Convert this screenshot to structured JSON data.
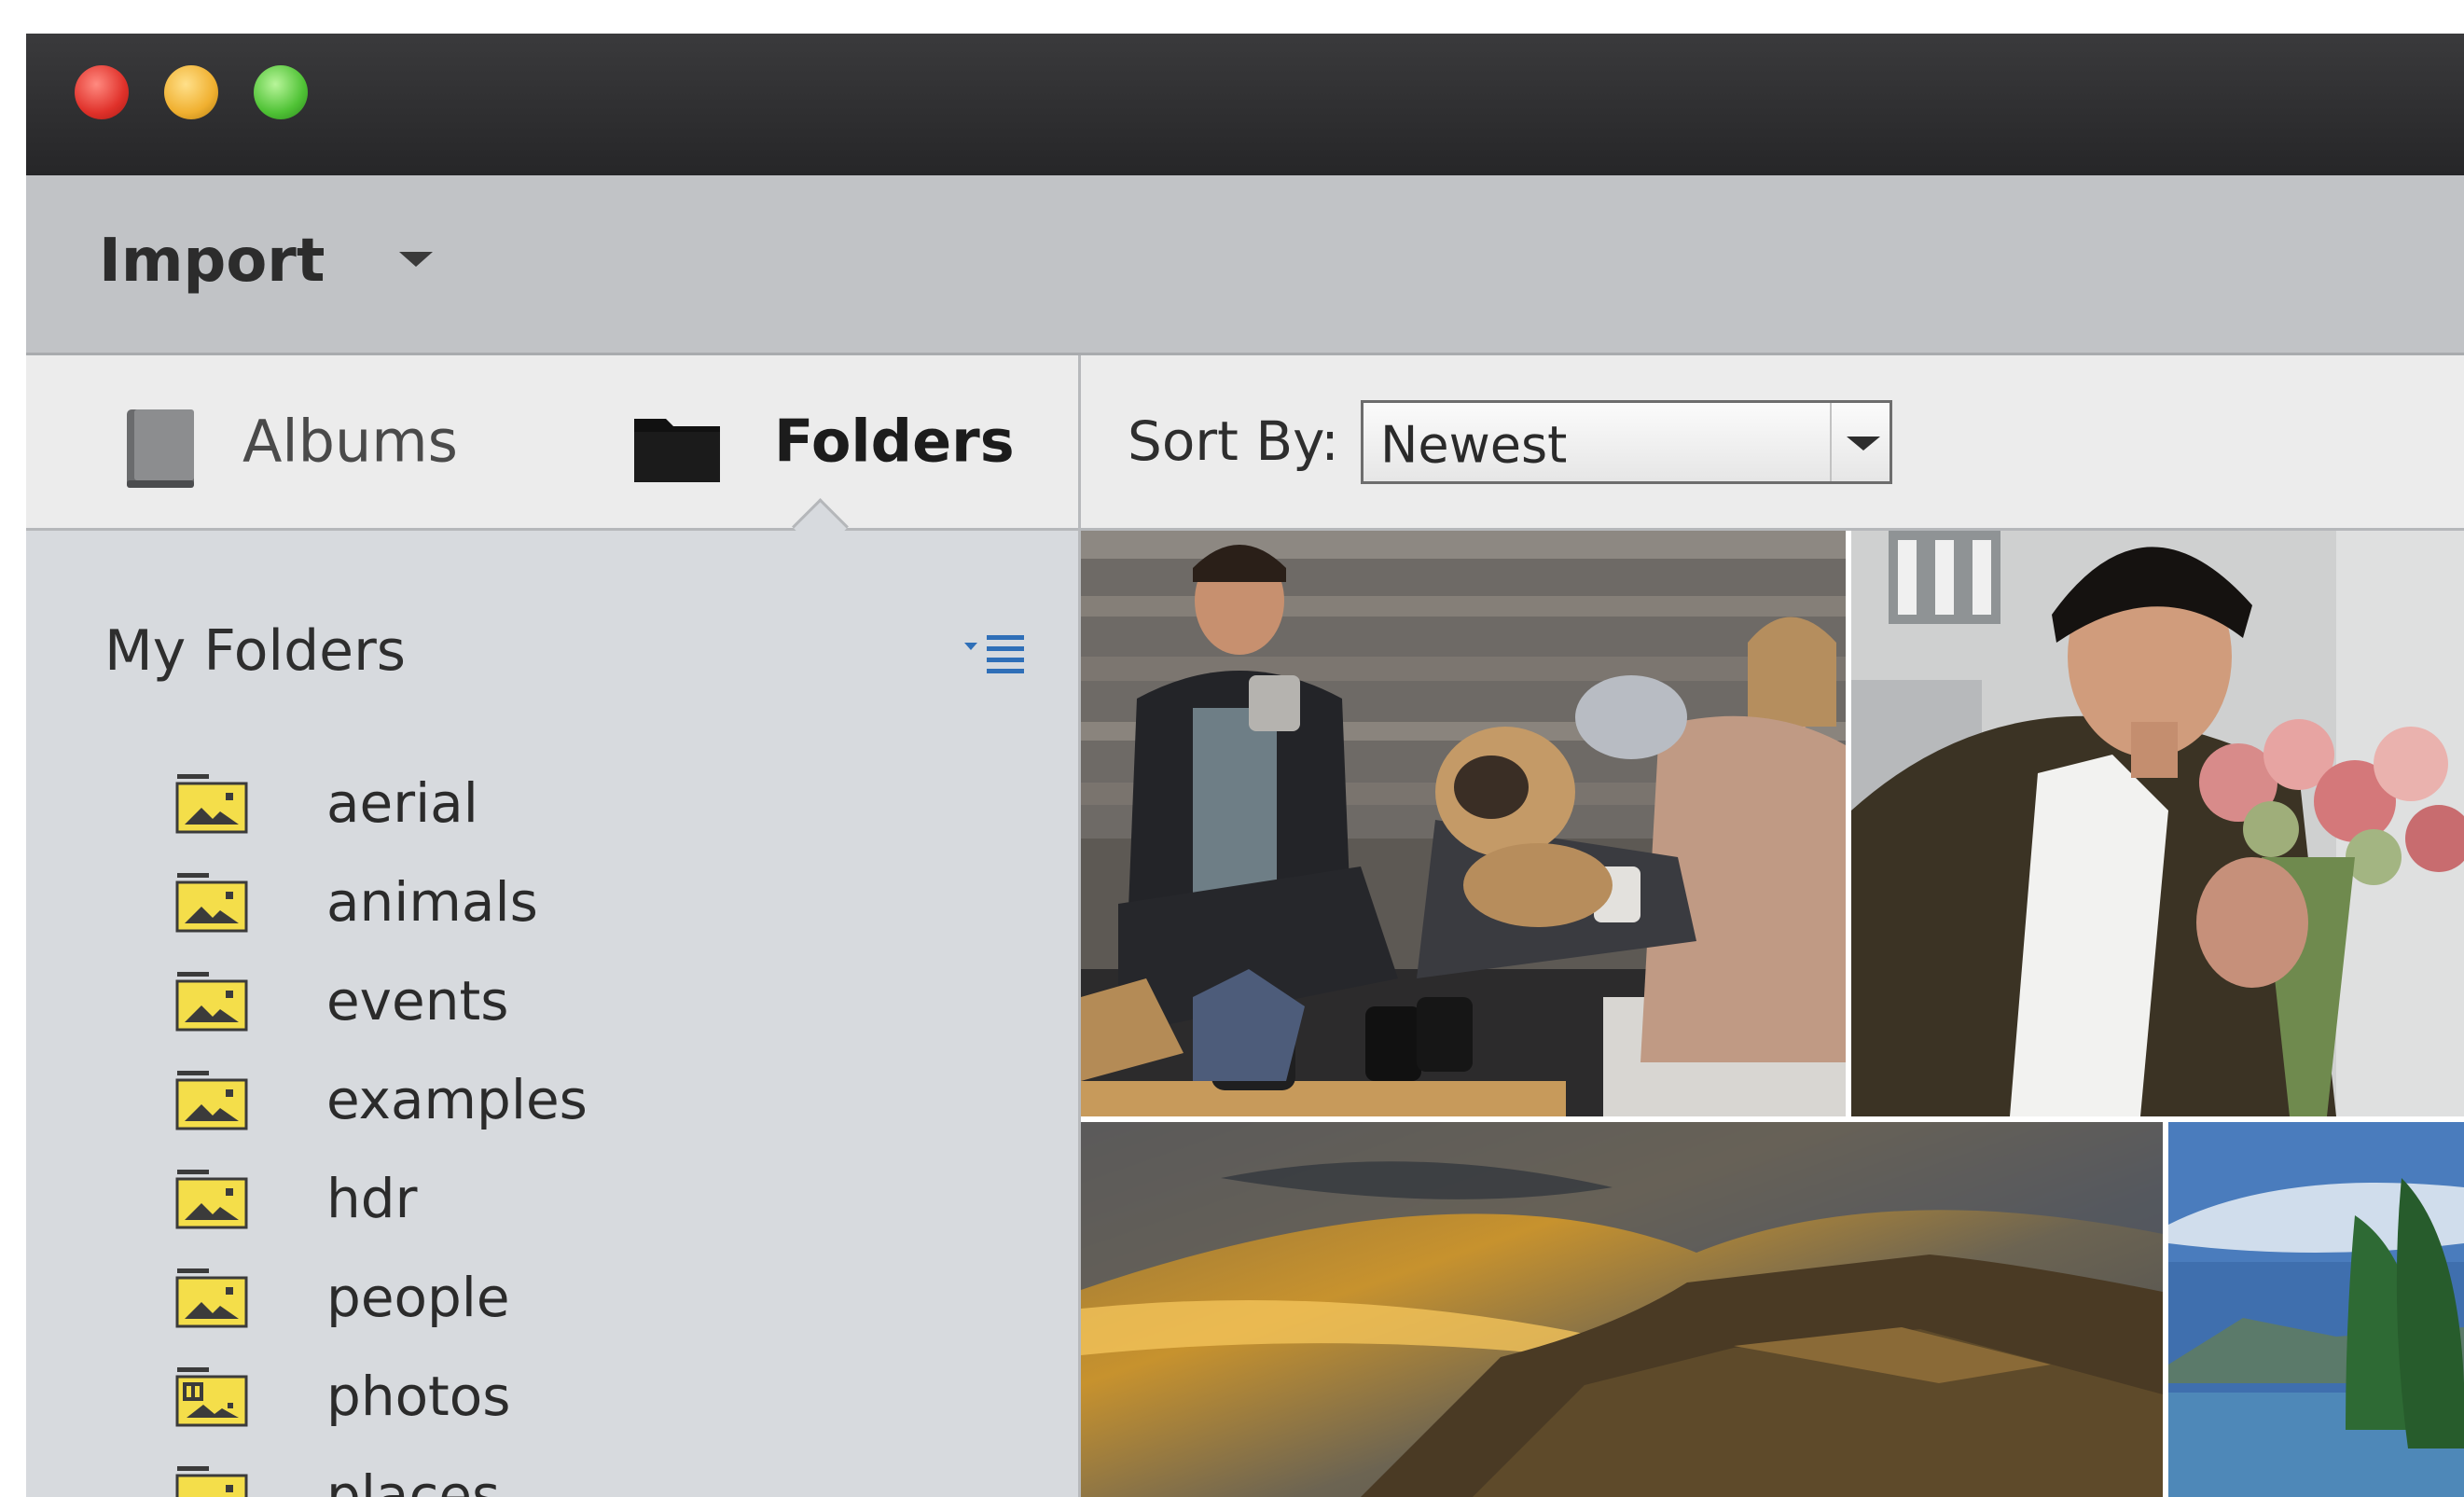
{
  "window": {
    "title_buttons": [
      "close",
      "minimize",
      "zoom"
    ]
  },
  "toolbar": {
    "import_label": "Import",
    "import_icon": "chevron-down-icon"
  },
  "sidebar": {
    "tabs": [
      {
        "label": "Albums",
        "icon": "album-book-icon",
        "selected": false
      },
      {
        "label": "Folders",
        "icon": "folder-icon",
        "selected": true
      }
    ],
    "section_title": "My Folders",
    "section_icon": "sort-list-icon",
    "folders": [
      {
        "label": "aerial",
        "icon": "image-folder-icon"
      },
      {
        "label": "animals",
        "icon": "image-folder-icon"
      },
      {
        "label": "events",
        "icon": "image-folder-icon"
      },
      {
        "label": "examples",
        "icon": "image-folder-icon"
      },
      {
        "label": "hdr",
        "icon": "image-folder-icon"
      },
      {
        "label": "people",
        "icon": "image-folder-icon"
      },
      {
        "label": "photos",
        "icon": "managed-image-folder-icon"
      },
      {
        "label": "places",
        "icon": "image-folder-icon"
      }
    ]
  },
  "content": {
    "sort_label": "Sort By:",
    "sort_value": "Newest",
    "photos": [
      {
        "subject": "couple with dog and mugs"
      },
      {
        "subject": "man smelling flowers"
      },
      {
        "subject": "sunset over cliffs"
      },
      {
        "subject": "lake with trees"
      }
    ]
  },
  "colors": {
    "titlebar": "#2b2b2d",
    "toolbar": "#c1c3c6",
    "sidebar": "#d7dade",
    "tabs": "#ececec",
    "folder_icon": "#f4de4a"
  }
}
